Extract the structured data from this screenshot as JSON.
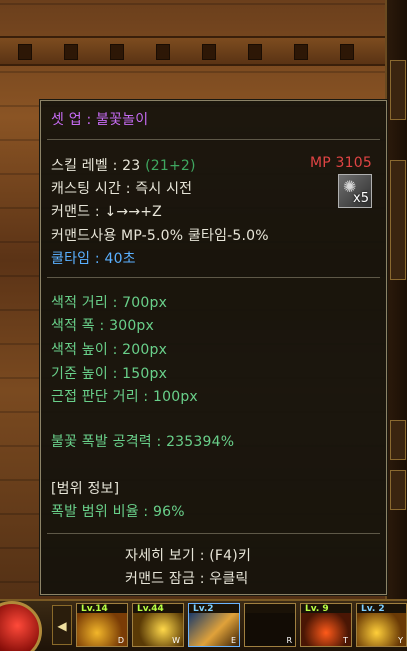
{
  "tooltip": {
    "title": "셋 업 : 불꽃놀이",
    "skill_level": "스킬 레벨 : 23",
    "skill_level_bonus": "(21+2)",
    "mp": "MP 3105",
    "cast_time": "캐스팅 시간 : 즉시 시전",
    "command": "커맨드 : ↓→→+Z",
    "command_use": "커맨드사용 MP-5.0% 쿨타임-5.0%",
    "cooldown": "쿨타임 : 40초",
    "icon_count": "x5",
    "icon_name": "skill-icon-fireworks",
    "search_distance": "색적 거리 : 700px",
    "search_width": "색적 폭 : 300px",
    "search_height": "색적 높이 : 200px",
    "base_height": "기준 높이 : 150px",
    "melee_distance": "근접 판단 거리 : 100px",
    "explosion_attack": "불꽃 폭발 공격력 : 235394%",
    "range_info_header": "[범위 정보]",
    "explosion_range": "폭발 범위 비율 : 96%",
    "detail_hint": "자세히 보기 : (F4)키",
    "command_lock": "커맨드 잠금 : 우클릭"
  },
  "hotbar": {
    "arrow": "◀",
    "slots": [
      {
        "level": "Lv.14",
        "key": "D"
      },
      {
        "level": "Lv.44",
        "key": "W"
      },
      {
        "level": "Lv.2",
        "key": "E"
      },
      {
        "level": "",
        "key": "R"
      },
      {
        "level": "Lv. 9",
        "key": "T"
      },
      {
        "level": "Lv. 2",
        "key": "Y"
      }
    ]
  },
  "colors": {
    "title": "#c56bf2",
    "text": "#e7e5d8",
    "value_green": "#69d08a",
    "cooldown_blue": "#5ab0ff",
    "mp_red": "#e04444",
    "level_badge": "#b8ff44"
  }
}
